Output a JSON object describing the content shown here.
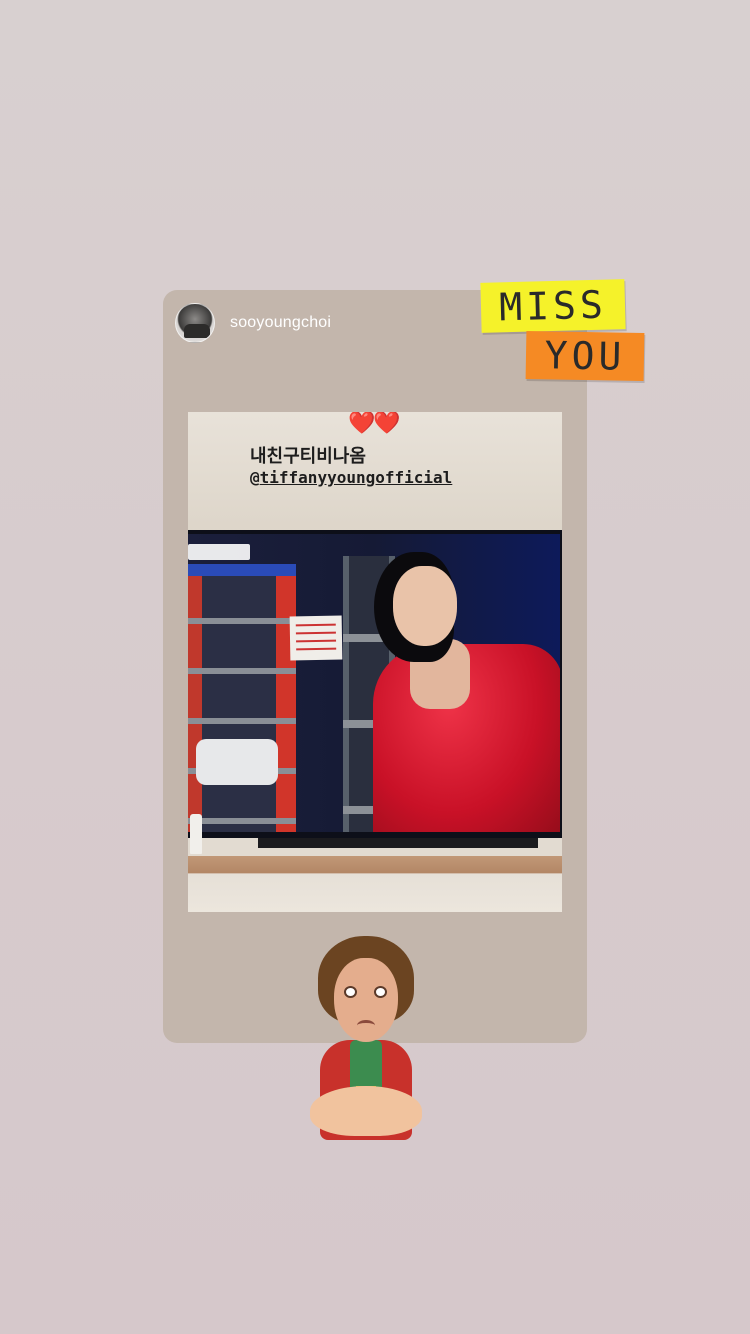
{
  "story": {
    "reshared_post": {
      "username": "sooyoungchoi",
      "avatar_icon": "profile-avatar",
      "photo": {
        "hearts": "❤️❤️",
        "caption_line1": "내친구티비나옴",
        "caption_at": "@",
        "caption_mention": "tiffanyyoungofficial"
      }
    },
    "stickers": {
      "miss_text": "MISS",
      "you_text": "YOU",
      "miss_color": "#f5f22a",
      "you_color": "#f58a24"
    },
    "colors": {
      "background": "#d8cfd0",
      "card": "#c3b6ac"
    }
  }
}
